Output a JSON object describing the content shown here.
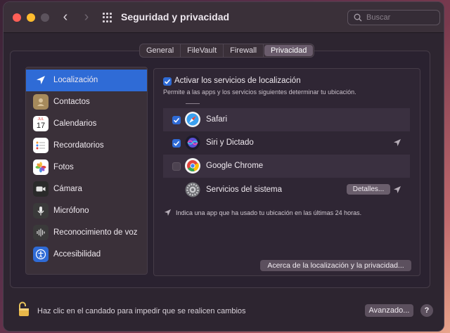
{
  "window": {
    "title": "Seguridad y privacidad"
  },
  "search": {
    "placeholder": "Buscar"
  },
  "tabs": [
    {
      "label": "General",
      "active": false
    },
    {
      "label": "FileVault",
      "active": false
    },
    {
      "label": "Firewall",
      "active": false
    },
    {
      "label": "Privacidad",
      "active": true
    }
  ],
  "sidebar": {
    "items": [
      {
        "label": "Localización",
        "icon": "location-arrow-icon",
        "selected": true
      },
      {
        "label": "Contactos",
        "icon": "contacts-book-icon"
      },
      {
        "label": "Calendarios",
        "icon": "calendar-icon",
        "calendar_month": "JUL",
        "calendar_day": "17"
      },
      {
        "label": "Recordatorios",
        "icon": "reminders-icon"
      },
      {
        "label": "Fotos",
        "icon": "photos-flower-icon"
      },
      {
        "label": "Cámara",
        "icon": "camera-icon"
      },
      {
        "label": "Micrófono",
        "icon": "microphone-icon"
      },
      {
        "label": "Reconocimiento de voz",
        "icon": "voice-waveform-icon"
      },
      {
        "label": "Accesibilidad",
        "icon": "accessibility-icon"
      }
    ]
  },
  "location": {
    "enable_label": "Activar los servicios de localización",
    "enabled": true,
    "description": "Permite a las apps y los servicios siguientes determinar tu ubicación."
  },
  "apps": [
    {
      "name": "Safari",
      "checked": true,
      "icon": "safari-compass-icon",
      "recent_use": false
    },
    {
      "name": "Siri y Dictado",
      "checked": true,
      "icon": "siri-orb-icon",
      "recent_use": true
    },
    {
      "name": "Google Chrome",
      "checked": false,
      "icon": "chrome-icon",
      "recent_use": false
    },
    {
      "name": "Servicios del sistema",
      "checked": null,
      "icon": "gear-icon",
      "recent_use": true,
      "details_label": "Detalles..."
    }
  ],
  "hint": "Indica una app que ha usado tu ubicación en las últimas 24 horas.",
  "about_button": "Acerca de la localización y la privacidad...",
  "footer": {
    "lock_text": "Haz clic en el candado para impedir que se realicen cambios",
    "advanced_label": "Avanzado...",
    "help_label": "?"
  },
  "colors": {
    "accent": "#2f6bd6",
    "window_bg": "#2d2530"
  }
}
